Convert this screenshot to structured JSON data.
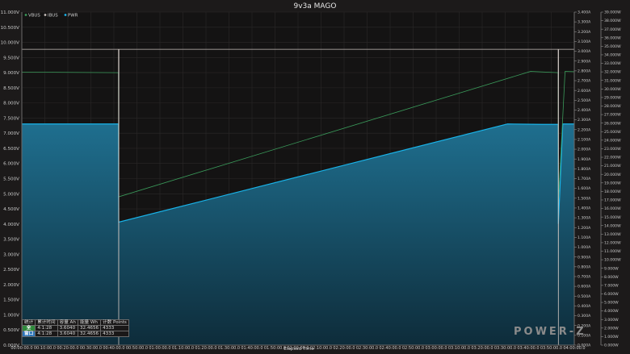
{
  "chart_data": {
    "type": "area",
    "title": "9v3a MAGO",
    "xlabel": "Elapsed Time",
    "x_ticks": [
      "00:00:00.0",
      "00:10:00.0",
      "00:20:00.0",
      "00:30:00.0",
      "00:40:00.0",
      "00:50:00.0",
      "01:00:00.0",
      "01:10:00.0",
      "01:20:00.0",
      "01:30:00.0",
      "01:40:00.0",
      "01:50:00.0",
      "02:00:00.0",
      "02:10:00.0",
      "02:20:00.0",
      "02:30:00.0",
      "02:40:00.0",
      "02:50:00.0",
      "03:00:00.0",
      "03:10:00.0",
      "03:20:00.0",
      "03:30:00.0",
      "03:40:00.0",
      "03:50:00.0",
      "04:00:00.0"
    ],
    "xlim_minutes": [
      0,
      240
    ],
    "grid": true,
    "legend": [
      "VBUS",
      "IBUS",
      "PWR"
    ],
    "axes": {
      "left": {
        "unit": "V",
        "min": 0,
        "max": 11,
        "step": 0.5,
        "ticks": [
          "0.000V",
          "0.500V",
          "1.000V",
          "1.500V",
          "2.000V",
          "2.500V",
          "3.000V",
          "3.500V",
          "4.000V",
          "4.500V",
          "5.000V",
          "5.500V",
          "6.000V",
          "6.500V",
          "7.000V",
          "7.500V",
          "8.000V",
          "8.500V",
          "9.000V",
          "9.500V",
          "10.000V",
          "10.500V",
          "11.000V"
        ]
      },
      "middle": {
        "unit": "A",
        "min": 0,
        "max": 3.4,
        "step": 0.1,
        "ticks": [
          "0.000A",
          "0.100A",
          "0.200A",
          "0.300A",
          "0.400A",
          "0.500A",
          "0.600A",
          "0.700A",
          "0.800A",
          "0.900A",
          "1.000A",
          "1.100A",
          "1.200A",
          "1.300A",
          "1.400A",
          "1.500A",
          "1.600A",
          "1.700A",
          "1.800A",
          "1.900A",
          "2.000A",
          "2.100A",
          "2.200A",
          "2.300A",
          "2.400A",
          "2.500A",
          "2.600A",
          "2.700A",
          "2.800A",
          "2.900A",
          "3.000A",
          "3.100A",
          "3.200A",
          "3.300A",
          "3.400A"
        ]
      },
      "right": {
        "unit": "W",
        "min": 0,
        "max": 39,
        "step": 1,
        "ticks": [
          "0.000W",
          "1.000W",
          "2.000W",
          "3.000W",
          "4.000W",
          "5.000W",
          "6.000W",
          "7.000W",
          "8.000W",
          "9.000W",
          "10.000W",
          "11.000W",
          "12.000W",
          "13.000W",
          "14.000W",
          "15.000W",
          "16.000W",
          "17.000W",
          "18.000W",
          "19.000W",
          "20.000W",
          "21.000W",
          "22.000W",
          "23.000W",
          "24.000W",
          "25.000W",
          "26.000W",
          "27.000W",
          "28.000W",
          "29.000W",
          "30.000W",
          "31.000W",
          "32.000W",
          "33.000W",
          "34.000W",
          "35.000W",
          "36.000W",
          "37.000W",
          "38.000W",
          "39.000W"
        ]
      }
    },
    "series": [
      {
        "name": "VBUS",
        "axis": "left",
        "color": "#3a9a5a",
        "points": [
          [
            0,
            9.02
          ],
          [
            42,
            9.0
          ],
          [
            42.1,
            4.9
          ],
          [
            221,
            9.04
          ],
          [
            233,
            9.0
          ],
          [
            233.1,
            4.7
          ],
          [
            236,
            9.04
          ],
          [
            240,
            9.03
          ]
        ]
      },
      {
        "name": "IBUS",
        "axis": "middle",
        "color": "#c8c0bc",
        "points": [
          [
            0,
            3.02
          ],
          [
            42,
            3.02
          ],
          [
            42.1,
            0.0
          ],
          [
            42.2,
            3.02
          ],
          [
            233,
            3.02
          ],
          [
            233.1,
            0.0
          ],
          [
            233.2,
            3.02
          ],
          [
            240,
            3.02
          ]
        ]
      },
      {
        "name": "PWR",
        "axis": "right",
        "color": "#19b4ea",
        "fill": true,
        "points": [
          [
            0,
            25.9
          ],
          [
            42,
            25.9
          ],
          [
            42.1,
            14.4
          ],
          [
            211,
            25.9
          ],
          [
            226,
            25.85
          ],
          [
            233,
            25.85
          ],
          [
            233.1,
            14.2
          ],
          [
            235,
            25.9
          ],
          [
            240,
            25.9
          ]
        ]
      }
    ]
  },
  "stats_table": {
    "headers": [
      "统计",
      "累计时间",
      "容量 Ah",
      "能量 Wh",
      "计数 Points"
    ],
    "rows": [
      {
        "tag": "全",
        "tag_color": "#2f8a3c",
        "cells": [
          "4:1:28",
          "3.6040",
          "32.4656",
          "4333"
        ]
      },
      {
        "tag": "窗口",
        "tag_color": "#2b74b8",
        "cells": [
          "4:1:28",
          "3.6040",
          "32.4656",
          "4333"
        ]
      }
    ]
  },
  "brand": {
    "logo_text": "POWER-Z"
  }
}
